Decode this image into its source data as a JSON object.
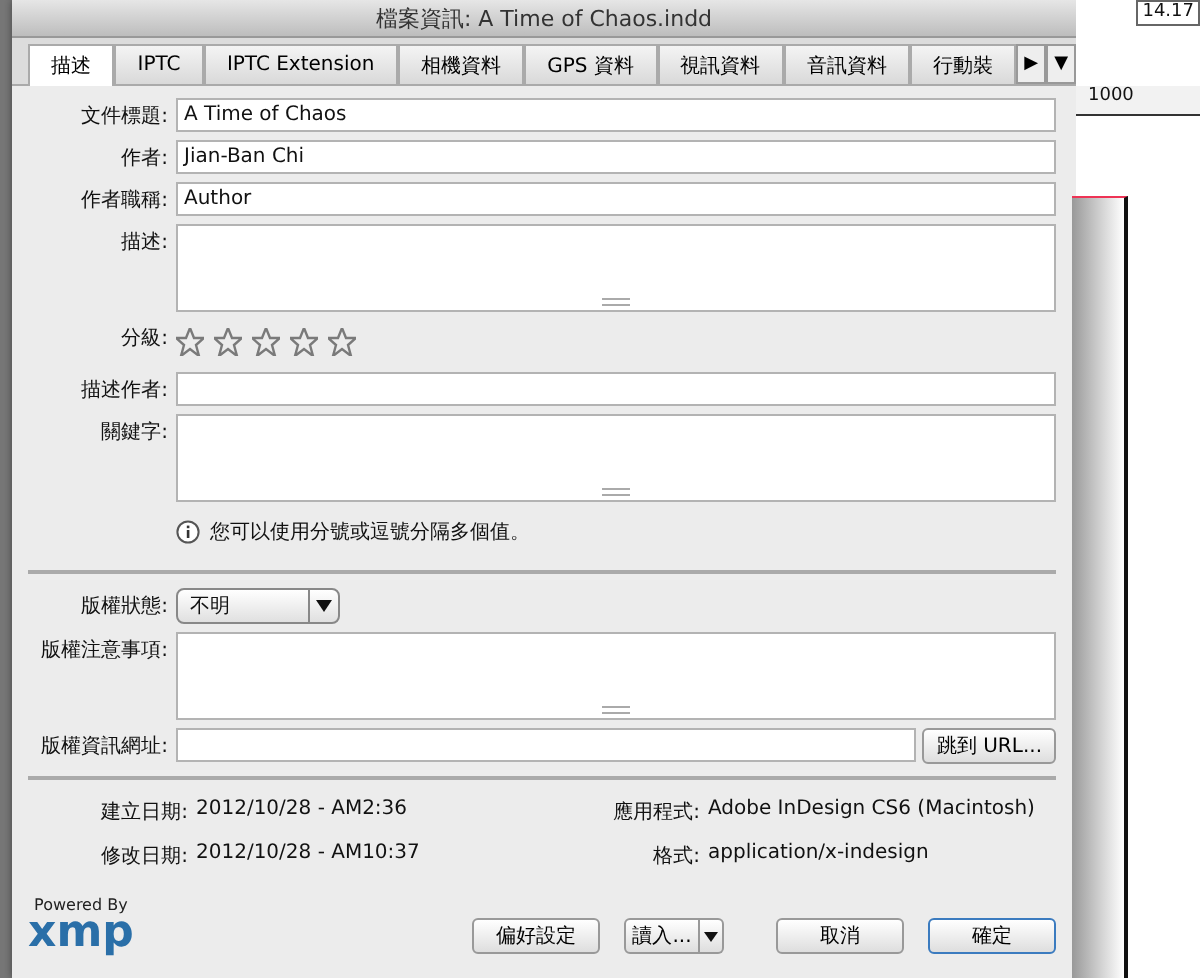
{
  "background": {
    "zoom_value": "14.17",
    "ruler_label": "1000"
  },
  "window": {
    "title": "檔案資訊: A Time of Chaos.indd"
  },
  "tabs": [
    {
      "label": "描述",
      "selected": true
    },
    {
      "label": "IPTC",
      "selected": false
    },
    {
      "label": "IPTC Extension",
      "selected": false
    },
    {
      "label": "相機資料",
      "selected": false
    },
    {
      "label": "GPS 資料",
      "selected": false
    },
    {
      "label": "視訊資料",
      "selected": false
    },
    {
      "label": "音訊資料",
      "selected": false
    },
    {
      "label": "行動裝",
      "selected": false
    }
  ],
  "tab_scroll": {
    "next": "▶",
    "menu": "▼"
  },
  "fields": [
    {
      "kind": "text",
      "label": "文件標題:",
      "value": "A Time of Chaos"
    },
    {
      "kind": "text",
      "label": "作者:",
      "value": "Jian-Ban Chi"
    },
    {
      "kind": "text",
      "label": "作者職稱:",
      "value": "Author"
    },
    {
      "kind": "textarea",
      "label": "描述:"
    },
    {
      "kind": "stars",
      "label": "分級:",
      "stars": 0
    },
    {
      "kind": "text",
      "label": "描述作者:"
    },
    {
      "kind": "textarea",
      "label": "關鍵字:"
    }
  ],
  "note": "您可以使用分號或逗號分隔多個值。",
  "copyright": [
    {
      "kind": "dropdown",
      "label": "版權狀態:",
      "value": "不明"
    },
    {
      "kind": "textarea",
      "label": "版權注意事項:"
    },
    {
      "kind": "url",
      "label": "版權資訊網址:",
      "button": "跳到 URL..."
    }
  ],
  "info": [
    {
      "label": "建立日期:",
      "value": "2012/10/28 - AM2:36"
    },
    {
      "label": "應用程式:",
      "value": "Adobe InDesign CS6 (Macintosh)"
    },
    {
      "label": "修改日期:",
      "value": "2012/10/28 - AM10:37"
    },
    {
      "label": "格式:",
      "value": "application/x-indesign"
    }
  ],
  "logo": {
    "caption": "Powered By",
    "word": "xmp"
  },
  "buttons": [
    {
      "kind": "plain",
      "label": "偏好設定"
    },
    {
      "kind": "split",
      "label": "讀入..."
    },
    {
      "kind": "plain",
      "label": "取消"
    },
    {
      "kind": "default",
      "label": "確定"
    }
  ]
}
